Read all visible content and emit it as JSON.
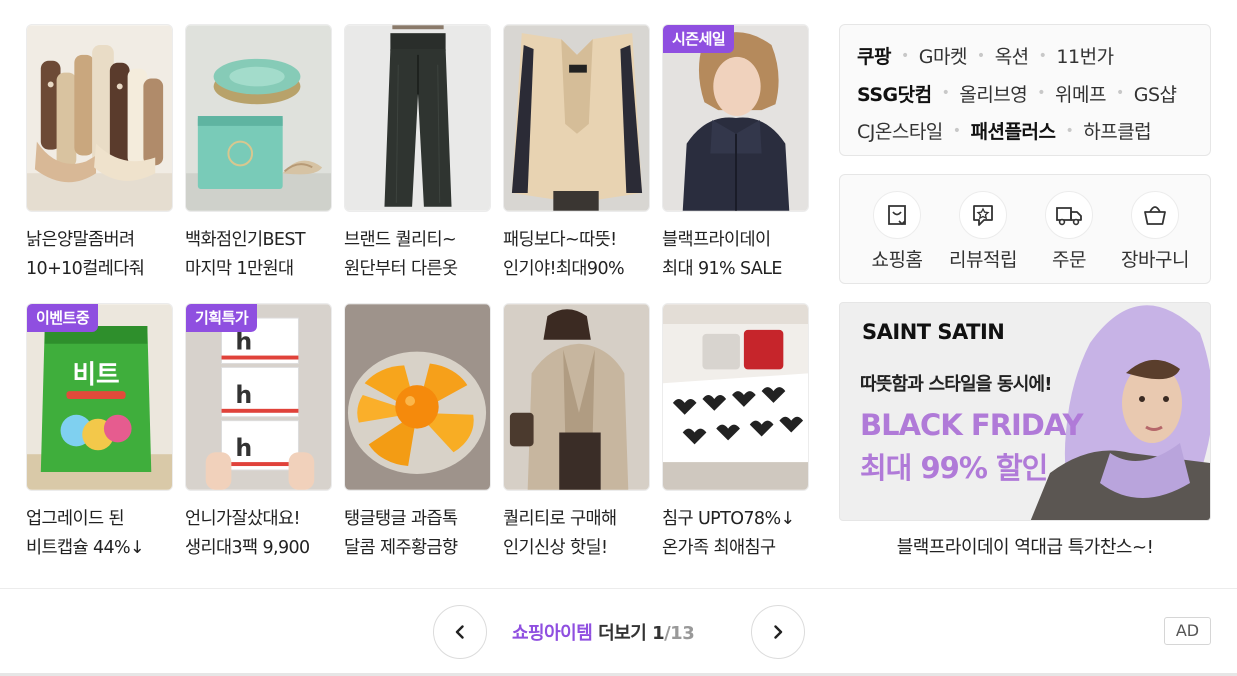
{
  "products": [
    {
      "caption1": "낡은양말좀버려",
      "caption2": "10+10컬레다줘",
      "badge": "",
      "image": "socks"
    },
    {
      "caption1": "백화점인기BEST",
      "caption2": "마지막 1만원대",
      "badge": "",
      "image": "cushion-compact"
    },
    {
      "caption1": "브랜드 퀄리티~",
      "caption2": "원단부터 다른옷",
      "badge": "",
      "image": "black-pants"
    },
    {
      "caption1": "패딩보다~따뜻!",
      "caption2": "인기야!최대90%",
      "badge": "",
      "image": "fleece-coat"
    },
    {
      "caption1": "블랙프라이데이",
      "caption2": "최대 91% SALE",
      "badge": "시즌세일",
      "image": "fleece-jacket-model"
    },
    {
      "caption1": "업그레이드 된",
      "caption2": "비트캡슐 44%↓",
      "badge": "이벤트중",
      "image": "detergent-pack"
    },
    {
      "caption1": "언니가잘샀대요!",
      "caption2": "생리대3팩 9,900",
      "badge": "기획특가",
      "image": "pad-boxes"
    },
    {
      "caption1": "탱글탱글 과즙톡",
      "caption2": "달콤 제주황금향",
      "badge": "",
      "image": "oranges"
    },
    {
      "caption1": "퀄리티로 구매해",
      "caption2": "인기신상 핫딜!",
      "badge": "",
      "image": "wool-jacket"
    },
    {
      "caption1": "침구 UPTO78%↓",
      "caption2": "온가족 최애침구",
      "badge": "",
      "image": "sofa-cover"
    }
  ],
  "malls": {
    "row1": [
      "쿠팡",
      "G마켓",
      "옥션",
      "11번가"
    ],
    "row2": [
      "SSG닷컴",
      "올리브영",
      "위메프",
      "GS샵"
    ],
    "row3": [
      "CJ온스타일",
      "패션플러스",
      "하프클럽"
    ],
    "bold": [
      "쿠팡",
      "SSG닷컴",
      "패션플러스"
    ]
  },
  "quick_links": [
    {
      "label": "쇼핑홈",
      "icon": "shopping-bag-icon"
    },
    {
      "label": "리뷰적립",
      "icon": "review-star-icon"
    },
    {
      "label": "주문",
      "icon": "delivery-truck-icon"
    },
    {
      "label": "장바구니",
      "icon": "basket-icon"
    }
  ],
  "banner": {
    "brand": "SAINT SATIN",
    "subtitle": "따뜻함과 스타일을 동시에!",
    "headline1": "BLACK FRIDAY",
    "headline2": "최대 99% 할인",
    "caption": "블랙프라이데이 역대급 특가찬스~!"
  },
  "pager": {
    "title_accent": "쇼핑아이템",
    "title_rest": "더보기",
    "current": "1",
    "total": "/13",
    "ad_label": "AD"
  },
  "colors": {
    "accent": "#8f4fe0",
    "banner_headline": "#b07ad8"
  }
}
